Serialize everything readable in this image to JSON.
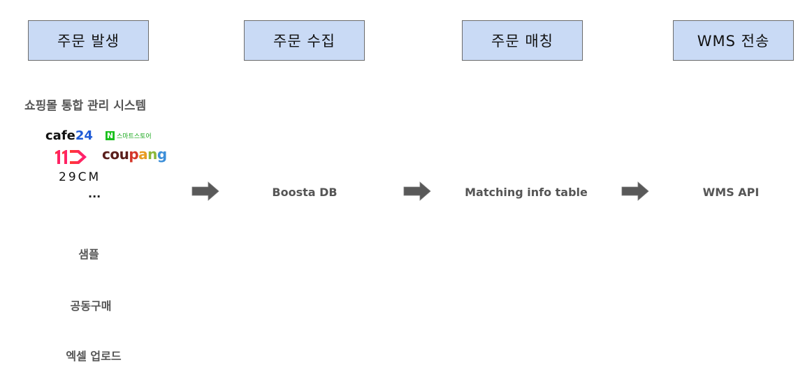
{
  "stages": [
    {
      "label": "주문 발생"
    },
    {
      "label": "주문 수집"
    },
    {
      "label": "주문 매칭"
    },
    {
      "label": "WMS 전송"
    }
  ],
  "sources": {
    "integrated_title": "쇼핑몰 통합 관리 시스템",
    "logos": {
      "cafe24_a": "cafe",
      "cafe24_b": "24",
      "smartstore_badge": "N",
      "smartstore_text": "스마트스토어",
      "coupang": [
        "cou",
        "p",
        "a",
        "n",
        "g"
      ],
      "twentynine_cm": "29CM",
      "eleven_st": "11st"
    },
    "more": "...",
    "others": [
      "샘플",
      "공동구매",
      "엑셀 업로드"
    ]
  },
  "flow_nodes": {
    "collection": "Boosta DB",
    "matching": "Matching info table",
    "transfer": "WMS API"
  },
  "colors": {
    "stage_fill": "#c9daf5",
    "stage_border": "#6b6b6b",
    "arrow_fill": "#595959",
    "label_text": "#555555"
  },
  "icons": {
    "arrow": "right-arrow-icon"
  }
}
